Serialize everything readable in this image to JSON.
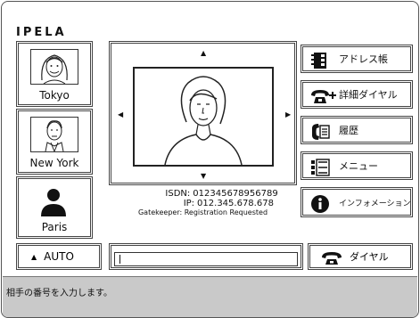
{
  "brand": {
    "logo": "IPELA"
  },
  "contacts": [
    {
      "name": "Tokyo",
      "icon": "girl-portrait-icon"
    },
    {
      "name": "New York",
      "icon": "man-portrait-icon"
    },
    {
      "name": "Paris",
      "icon": "person-silhouette-icon"
    }
  ],
  "preview": {
    "icon": "woman-portrait-icon"
  },
  "connection": {
    "isdn_label": "ISDN:",
    "isdn": "012345678956789",
    "ip_label": "IP:",
    "ip": "012.345.678.678",
    "gatekeeper_label": "Gatekeeper:",
    "gatekeeper": "Registration Requested"
  },
  "menu": {
    "address_book": "アドレス帳",
    "detail_dial": "詳細ダイヤル",
    "history": "履歴",
    "menu": "メニュー",
    "information": "インフォメーション"
  },
  "bottom": {
    "auto_label": "AUTO",
    "number_value": "",
    "dial_label": "ダイヤル"
  },
  "status": {
    "message": "相手の番号を入力します。"
  }
}
